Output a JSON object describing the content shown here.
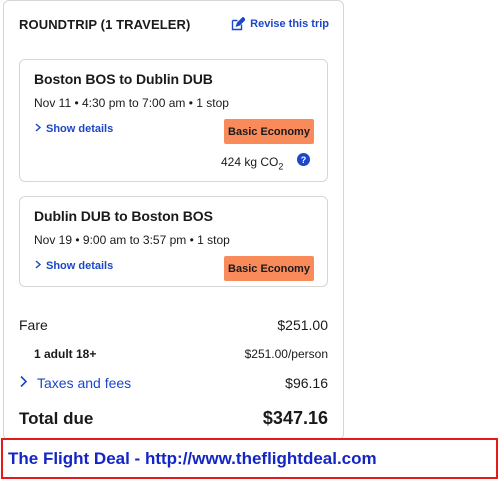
{
  "header": {
    "trip_title": "ROUNDTRIP (1 TRAVELER)",
    "revise_label": "Revise this trip"
  },
  "legs": [
    {
      "route": "Boston BOS to Dublin DUB",
      "times": "Nov 11 • 4:30 pm to 7:00 am • 1 stop",
      "show_details_label": "Show details",
      "fare_class": "Basic Economy",
      "co2_value": "424 kg CO",
      "co2_sub": "2",
      "help_icon": "?"
    },
    {
      "route": "Dublin DUB to Boston BOS",
      "times": "Nov 19 • 9:00 am to 3:57 pm • 1 stop",
      "show_details_label": "Show details",
      "fare_class": "Basic Economy"
    }
  ],
  "price": {
    "fare_label": "Fare",
    "fare_amount": "$251.00",
    "adult_label": "1 adult 18+",
    "adult_amount": "$251.00/person",
    "taxes_label": "Taxes and fees",
    "taxes_amount": "$96.16",
    "total_label": "Total due",
    "total_amount": "$347.16"
  },
  "banner": {
    "text": "The Flight Deal - http://www.theflightdeal.com"
  },
  "colors": {
    "link": "#1b47c8",
    "fare_badge": "#f98a5a",
    "banner_border": "#e31b1b",
    "banner_text": "#1326c5"
  },
  "icons": {
    "revise": "edit-icon",
    "show_details": "chevron-right-icon",
    "taxes": "chevron-right-icon",
    "help": "help-icon"
  }
}
